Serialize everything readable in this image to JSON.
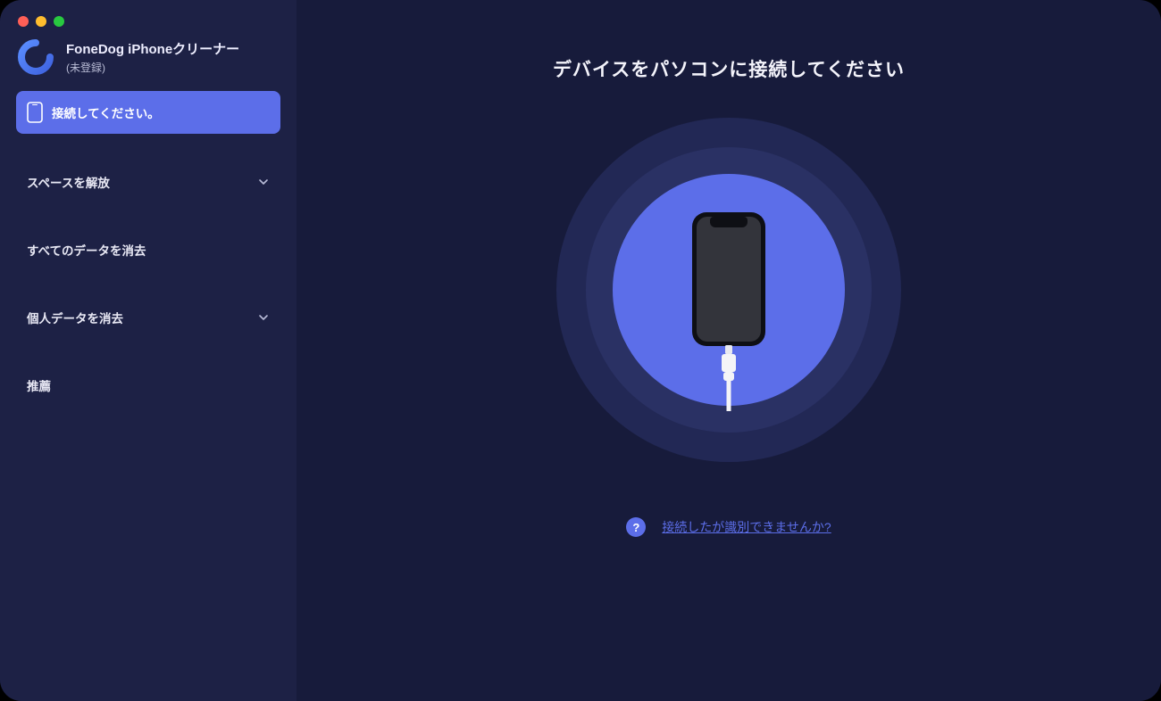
{
  "brand": {
    "title": "FoneDog iPhoneクリーナー",
    "subtitle": "(未登録)"
  },
  "sidebar": {
    "connect_label": "接続してください。",
    "items": [
      {
        "label": "スペースを解放",
        "has_chevron": true
      },
      {
        "label": "すべてのデータを消去",
        "has_chevron": false
      },
      {
        "label": "個人データを消去",
        "has_chevron": true
      },
      {
        "label": "推薦",
        "has_chevron": false
      }
    ]
  },
  "main": {
    "title": "デバイスをパソコンに接続してください",
    "help_link": "接続したが識別できませんか?"
  },
  "icons": {
    "phone": "phone-icon",
    "chevron_down": "chevron-down-icon",
    "question": "question-mark-icon",
    "logo": "fonedog-logo-icon",
    "cable": "lightning-cable-icon"
  },
  "colors": {
    "accent": "#5c6ee9",
    "bg_main": "#171b3b",
    "bg_sidebar": "#1d2145"
  }
}
